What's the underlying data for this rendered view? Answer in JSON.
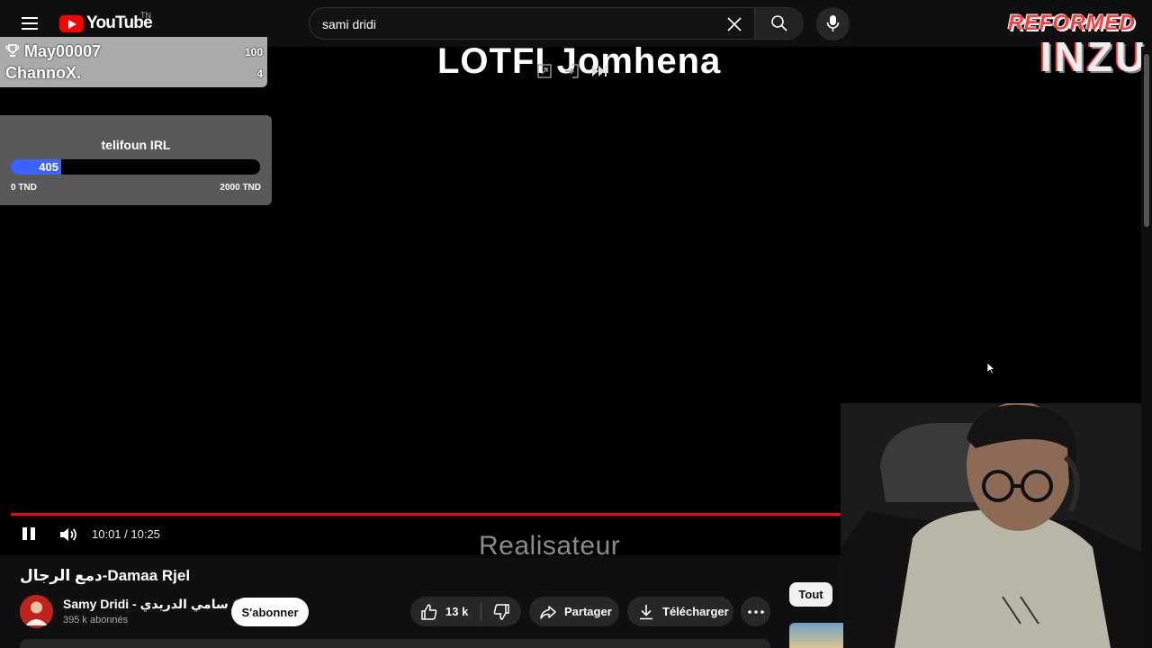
{
  "header": {
    "logo_text": "YouTube",
    "region": "TN",
    "search_value": "sami dridi"
  },
  "video": {
    "overlay_title_text": "LOTFI Jomhena",
    "overlay_credit_text": "Realisateur",
    "current_time": "10:01",
    "duration": "10:25",
    "time_display": "10:01 / 10:25",
    "progress_fraction": 0.961,
    "accent_color": "#ff0000"
  },
  "leaderboard": {
    "rows": [
      {
        "name": "May00007",
        "score": "100"
      },
      {
        "name": "ChannoX.",
        "score": "4"
      }
    ]
  },
  "goal": {
    "title": "telifoun IRL",
    "current": "405",
    "min_label": "0 TND",
    "max_label": "2000 TND",
    "fraction": 0.2025,
    "fill_color": "#3a63ff"
  },
  "stream_logo": {
    "line1": "REFORMED",
    "line2": "INZU"
  },
  "meta": {
    "title": "دمع الرجال-Damaa Rjel",
    "channel_name": "Samy Dridi - سامي الدريدي",
    "subscribers": "395 k abonnés",
    "subscribe_label": "S'abonner",
    "likes": "13 k",
    "share_label": "Partager",
    "download_label": "Télécharger",
    "chip_all_label": "Tout"
  }
}
